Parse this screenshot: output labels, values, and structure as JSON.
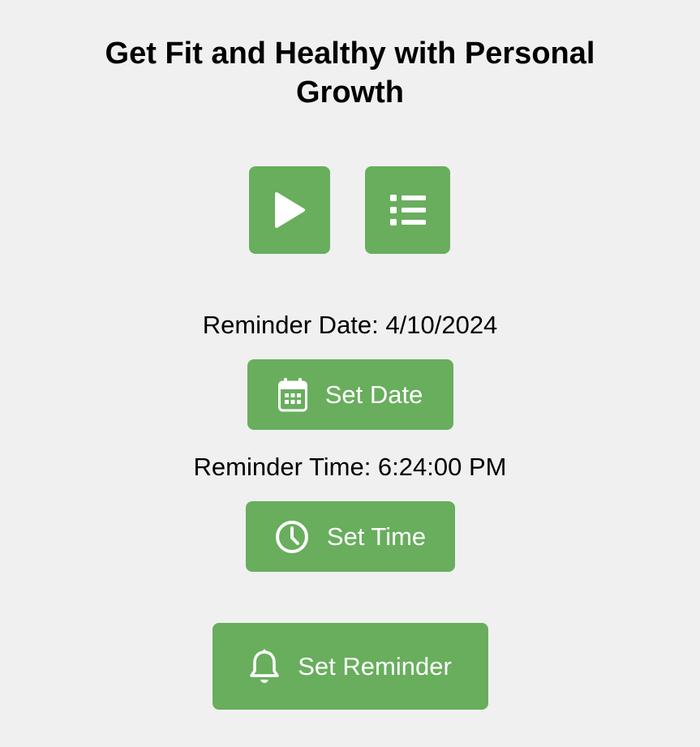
{
  "header": {
    "title": "Get Fit and Healthy with Personal Growth"
  },
  "media_controls": {
    "play_icon": "play-icon",
    "list_icon": "list-icon"
  },
  "reminder": {
    "date_label": "Reminder Date: 4/10/2024",
    "set_date_label": "Set Date",
    "set_date_icon": "calendar-icon",
    "time_label": "Reminder Time: 6:24:00 PM",
    "set_time_label": "Set Time",
    "set_time_icon": "clock-icon",
    "set_reminder_label": "Set Reminder",
    "set_reminder_icon": "bell-icon"
  },
  "colors": {
    "background": "#f0f0f0",
    "button": "#68ae5d",
    "button_text": "#ffffff",
    "text": "#000000"
  }
}
